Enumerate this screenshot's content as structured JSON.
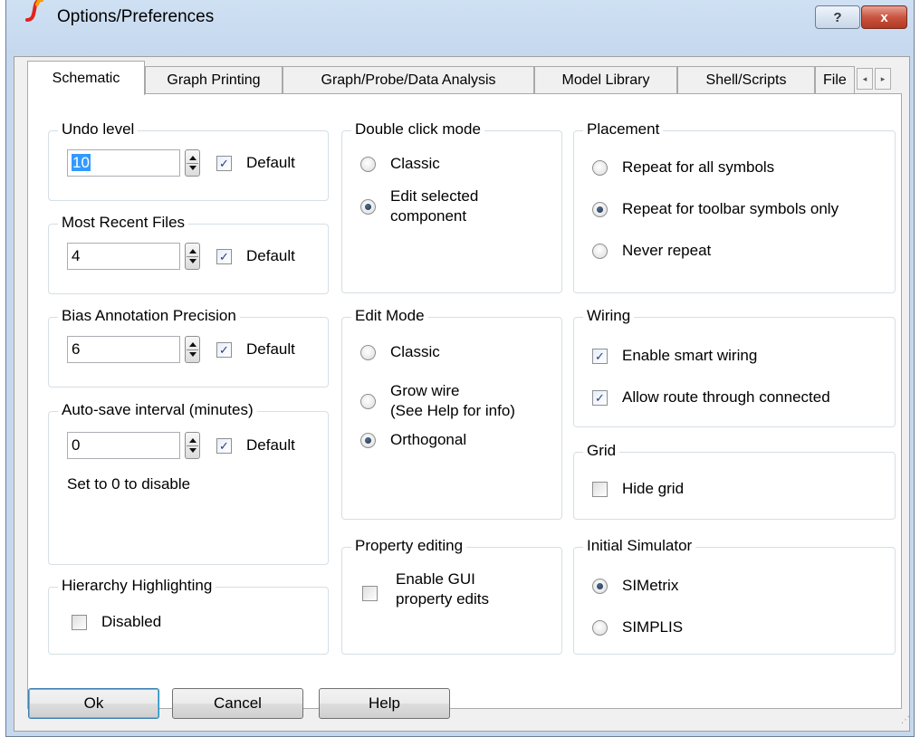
{
  "window": {
    "title": "Options/Preferences",
    "help_glyph": "?",
    "close_glyph": "x"
  },
  "tabs": [
    {
      "label": "Schematic",
      "active": true
    },
    {
      "label": "Graph Printing"
    },
    {
      "label": "Graph/Probe/Data Analysis"
    },
    {
      "label": "Model Library"
    },
    {
      "label": "Shell/Scripts"
    },
    {
      "label": "File"
    }
  ],
  "tab_scroll": {
    "left": "◂",
    "right": "▸"
  },
  "undo": {
    "title": "Undo level",
    "value": "10",
    "default_label": "Default",
    "default_checked": true
  },
  "recent": {
    "title": "Most Recent Files",
    "value": "4",
    "default_label": "Default",
    "default_checked": true
  },
  "bias": {
    "title": "Bias Annotation Precision",
    "value": "6",
    "default_label": "Default",
    "default_checked": true
  },
  "autosave": {
    "title": "Auto-save interval (minutes)",
    "value": "0",
    "default_label": "Default",
    "default_checked": true,
    "note": "Set to 0 to disable"
  },
  "hierarchy": {
    "title": "Hierarchy Highlighting",
    "option": "Disabled",
    "checked": false
  },
  "double_click": {
    "title": "Double click mode",
    "options": [
      {
        "line1": "Classic",
        "line2": "",
        "selected": false
      },
      {
        "line1": "Edit selected",
        "line2": "component",
        "selected": true
      }
    ]
  },
  "edit_mode": {
    "title": "Edit Mode",
    "options": [
      {
        "line1": "Classic",
        "line2": "",
        "selected": false
      },
      {
        "line1": "Grow wire",
        "line2": "(See Help for info)",
        "selected": false
      },
      {
        "line1": "Orthogonal",
        "line2": "",
        "selected": true
      }
    ]
  },
  "property_editing": {
    "title": "Property editing",
    "line1": "Enable GUI",
    "line2": "property edits",
    "checked": false
  },
  "placement": {
    "title": "Placement",
    "options": [
      {
        "label": "Repeat for all symbols",
        "selected": false
      },
      {
        "label": "Repeat for toolbar symbols only",
        "selected": true
      },
      {
        "label": "Never repeat",
        "selected": false
      }
    ]
  },
  "wiring": {
    "title": "Wiring",
    "options": [
      {
        "label": "Enable smart wiring",
        "checked": true
      },
      {
        "label": "Allow route through connected",
        "checked": true
      }
    ]
  },
  "grid": {
    "title": "Grid",
    "option": "Hide grid",
    "checked": false
  },
  "simulator": {
    "title": "Initial Simulator",
    "options": [
      {
        "label": "SIMetrix",
        "selected": true
      },
      {
        "label": "SIMPLIS",
        "selected": false
      }
    ]
  },
  "buttons": {
    "ok": "Ok",
    "cancel": "Cancel",
    "help": "Help"
  },
  "check_glyph": "✓",
  "grip_glyph": "⋰"
}
